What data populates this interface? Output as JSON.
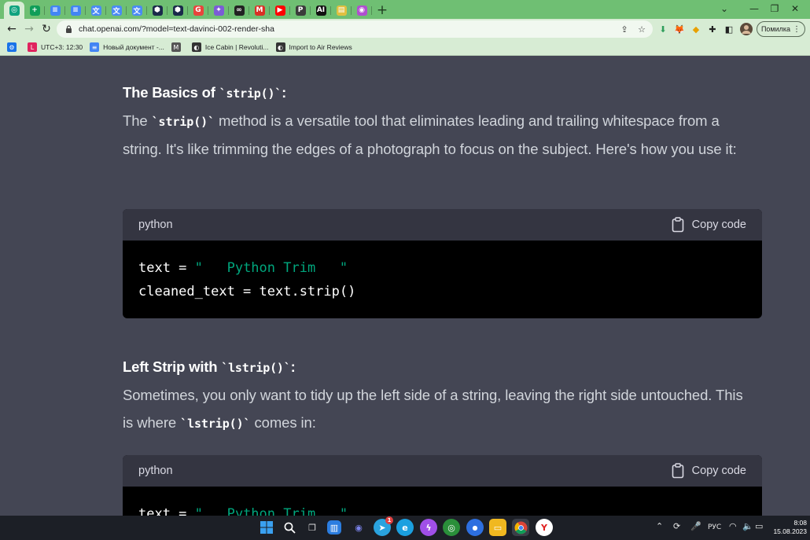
{
  "browser": {
    "tabs": [
      {
        "icon": "chatgpt-icon",
        "color": "#10a37f",
        "glyph": "◎",
        "active": true
      },
      {
        "icon": "google-sheets-icon",
        "color": "#0f9d58",
        "glyph": "+"
      },
      {
        "icon": "google-docs-icon",
        "color": "#4285f4",
        "glyph": "≡"
      },
      {
        "icon": "google-docs-icon",
        "color": "#4285f4",
        "glyph": "≡"
      },
      {
        "icon": "translate-icon",
        "color": "#4a8af4",
        "glyph": "文"
      },
      {
        "icon": "translate-icon",
        "color": "#4a8af4",
        "glyph": "文"
      },
      {
        "icon": "translate-icon",
        "color": "#4a8af4",
        "glyph": "文"
      },
      {
        "icon": "hexagon-icon",
        "color": "#1a2a4a",
        "glyph": "⬢"
      },
      {
        "icon": "hexagon-icon",
        "color": "#1a2a4a",
        "glyph": "⬢"
      },
      {
        "icon": "grammarly-icon",
        "color": "#e8453c",
        "glyph": "G"
      },
      {
        "icon": "sparkle-icon",
        "color": "#7b5cd6",
        "glyph": "✦"
      },
      {
        "icon": "link-icon",
        "color": "#222222",
        "glyph": "∞"
      },
      {
        "icon": "gmail-icon",
        "color": "#d93025",
        "glyph": "M"
      },
      {
        "icon": "youtube-icon",
        "color": "#ff0000",
        "glyph": "▶"
      },
      {
        "icon": "p-icon",
        "color": "#3b3b3b",
        "glyph": "P"
      },
      {
        "icon": "ai-icon",
        "color": "#111111",
        "glyph": "AI"
      },
      {
        "icon": "document-icon",
        "color": "#e0c040",
        "glyph": "▤"
      },
      {
        "icon": "circle-app-icon",
        "color": "#b04fd0",
        "glyph": "◉"
      }
    ],
    "new_tab": "+",
    "url": "chat.openai.com/?model=text-davinci-002-render-sha",
    "profile_label": "Помилка",
    "bookmarks": [
      {
        "label": "",
        "icon": "settings-gear-icon",
        "color": "#1a73e8",
        "glyph": "⚙"
      },
      {
        "label": "UTC+3: 12:30",
        "icon": "clock-icon",
        "color": "#e0245e",
        "glyph": "L"
      },
      {
        "label": "Новый документ -...",
        "icon": "google-docs-icon",
        "color": "#4285f4",
        "glyph": "≡"
      },
      {
        "label": "",
        "icon": "mw-icon",
        "color": "#555555",
        "glyph": "M"
      },
      {
        "label": "Ice Cabin | Revoluti...",
        "icon": "globe-icon",
        "color": "#333333",
        "glyph": "◐"
      },
      {
        "label": "Import to Air Reviews",
        "icon": "globe-icon",
        "color": "#333333",
        "glyph": "◐"
      }
    ]
  },
  "article": {
    "section1_title_prefix": "The Basics of ",
    "section1_title_code": "`strip()`",
    "section1_title_suffix": ":",
    "para1_a": "The ",
    "para1_code": "`strip()`",
    "para1_b": " method is a versatile tool that eliminates leading and trailing whitespace from a string. It's like trimming the edges of a photograph to focus on the subject. Here's how you use it:",
    "code1": {
      "lang": "python",
      "copy_label": "Copy code",
      "line1_a": "text = ",
      "line1_str": "\"   Python Trim   \"",
      "line2": "cleaned_text = text.strip()"
    },
    "section2_title_prefix": "Left Strip with ",
    "section2_title_code": "`lstrip()`",
    "section2_title_suffix": ":",
    "para2_a": "Sometimes, you only want to tidy up the left side of a string, leaving the right side untouched. This is where ",
    "para2_code": "`lstrip()`",
    "para2_b": " comes in:",
    "code2": {
      "lang": "python",
      "copy_label": "Copy code",
      "line1_a": "text = ",
      "line1_str": "\"   Python Trim   \""
    }
  },
  "taskbar": {
    "lang": "РУС",
    "time": "8:08",
    "date": "15.08.2023",
    "telegram_badge": "1"
  }
}
